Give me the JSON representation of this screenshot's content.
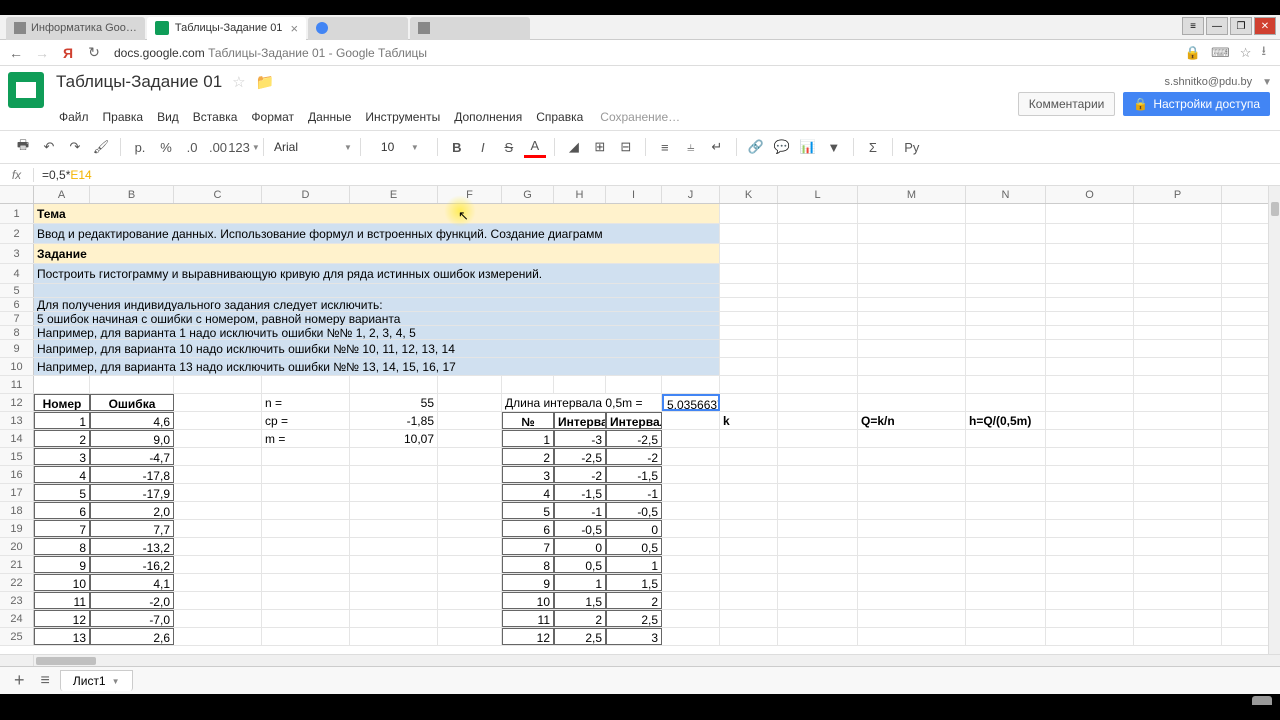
{
  "browser": {
    "tabs": [
      {
        "label": "Информатика Goo…",
        "active": false
      },
      {
        "label": "Таблицы-Задание 01",
        "active": true
      },
      {
        "label": "",
        "active": false
      },
      {
        "label": "",
        "active": false
      }
    ],
    "url_domain": "docs.google.com",
    "url_path": "   Таблицы-Задание 01 - Google Таблицы"
  },
  "window_controls": [
    "▬",
    "—",
    "❐",
    "✕"
  ],
  "header": {
    "doc_title": "Таблицы-Задание 01",
    "user_email": "s.shnitko@pdu.by",
    "comments_btn": "Комментарии",
    "share_btn": "Настройки доступа"
  },
  "menus": [
    "Файл",
    "Правка",
    "Вид",
    "Вставка",
    "Формат",
    "Данные",
    "Инструменты",
    "Дополнения",
    "Справка"
  ],
  "saving_label": "Сохранение…",
  "toolbar": {
    "font": "Arial",
    "size": "10",
    "format_123": "123"
  },
  "formula_bar": {
    "prefix": "=0,5*",
    "ref": "E14"
  },
  "columns": [
    {
      "label": "A",
      "w": 56
    },
    {
      "label": "B",
      "w": 84
    },
    {
      "label": "C",
      "w": 88
    },
    {
      "label": "D",
      "w": 88
    },
    {
      "label": "E",
      "w": 88
    },
    {
      "label": "F",
      "w": 64
    },
    {
      "label": "G",
      "w": 52
    },
    {
      "label": "H",
      "w": 52
    },
    {
      "label": "I",
      "w": 56
    },
    {
      "label": "J",
      "w": 58
    },
    {
      "label": "K",
      "w": 58
    },
    {
      "label": "L",
      "w": 80
    },
    {
      "label": "M",
      "w": 108
    },
    {
      "label": "N",
      "w": 80
    },
    {
      "label": "O",
      "w": 88
    },
    {
      "label": "P",
      "w": 88
    }
  ],
  "sheet_rows": [
    {
      "n": 1,
      "h": 20,
      "cells": [
        {
          "c": 0,
          "span": 10,
          "cls": "bold bg-yellow",
          "t": "Тема"
        }
      ]
    },
    {
      "n": 2,
      "h": 20,
      "cells": [
        {
          "c": 0,
          "span": 10,
          "cls": "bg-blue",
          "t": "Ввод и редактирование данных. Использование формул и встроенных функций. Создание диаграмм"
        }
      ]
    },
    {
      "n": 3,
      "h": 20,
      "cells": [
        {
          "c": 0,
          "span": 10,
          "cls": "bold bg-yellow",
          "t": "Задание"
        }
      ]
    },
    {
      "n": 4,
      "h": 20,
      "cells": [
        {
          "c": 0,
          "span": 10,
          "cls": "bg-blue",
          "t": "Построить гистограмму и выравнивающую кривую для ряда истинных ошибок измерений."
        }
      ]
    },
    {
      "n": 5,
      "h": 14,
      "cells": [
        {
          "c": 0,
          "span": 10,
          "cls": "bg-blue",
          "t": ""
        }
      ]
    },
    {
      "n": 6,
      "h": 14,
      "cells": [
        {
          "c": 0,
          "span": 10,
          "cls": "bg-blue",
          "t": "Для получения индивидуального задания следует исключить:"
        }
      ]
    },
    {
      "n": 7,
      "h": 14,
      "cells": [
        {
          "c": 0,
          "span": 10,
          "cls": "bg-blue",
          "t": "5 ошибок начиная с ошибки с номером, равной номеру варианта"
        }
      ]
    },
    {
      "n": 8,
      "h": 14,
      "cells": [
        {
          "c": 0,
          "span": 10,
          "cls": "bg-blue",
          "t": "Например, для варианта 1 надо исключить ошибки №№ 1, 2, 3, 4, 5"
        }
      ]
    },
    {
      "n": 9,
      "h": 18,
      "cells": [
        {
          "c": 0,
          "span": 10,
          "cls": "bg-blue",
          "t": "Например, для варианта 10 надо исключить ошибки №№ 10, 11, 12, 13, 14"
        }
      ]
    },
    {
      "n": 10,
      "h": 18,
      "cells": [
        {
          "c": 0,
          "span": 10,
          "cls": "bg-blue",
          "t": "Например, для варианта 13 надо исключить ошибки №№ 13, 14, 15, 16, 17"
        }
      ]
    },
    {
      "n": 11,
      "h": 18,
      "cells": []
    },
    {
      "n": 12,
      "h": 18,
      "cells": [
        {
          "c": 0,
          "cls": "bold center bordered",
          "t": "Номер"
        },
        {
          "c": 1,
          "cls": "bold center bordered",
          "t": "Ошибка"
        },
        {
          "c": 3,
          "t": "n ="
        },
        {
          "c": 4,
          "cls": "right",
          "t": "55"
        },
        {
          "c": 6,
          "span": 3,
          "t": "Длина интервала 0,5m ="
        },
        {
          "c": 9,
          "cls": "right selected-cell",
          "t": "5,0356637"
        }
      ]
    },
    {
      "n": 13,
      "h": 18,
      "cells": [
        {
          "c": 0,
          "cls": "right bordered",
          "t": "1"
        },
        {
          "c": 1,
          "cls": "right bordered",
          "t": "4,6"
        },
        {
          "c": 3,
          "t": "ср ="
        },
        {
          "c": 4,
          "cls": "right",
          "t": "-1,85"
        },
        {
          "c": 6,
          "cls": "bold center bordered",
          "t": "№"
        },
        {
          "c": 7,
          "cls": "bold bordered",
          "t": "Интервал в долях m"
        },
        {
          "c": 8,
          "cls": "bold bordered",
          "t": "Интервал"
        },
        {
          "c": 10,
          "cls": "bold",
          "t": "k"
        },
        {
          "c": 12,
          "cls": "bold",
          "t": "Q=k/n"
        },
        {
          "c": 13,
          "cls": "bold",
          "t": "h=Q/(0,5m)"
        }
      ]
    },
    {
      "n": 14,
      "h": 18,
      "cells": [
        {
          "c": 0,
          "cls": "right bordered",
          "t": "2"
        },
        {
          "c": 1,
          "cls": "right bordered",
          "t": "9,0"
        },
        {
          "c": 3,
          "t": "m ="
        },
        {
          "c": 4,
          "cls": "right",
          "t": "10,07"
        },
        {
          "c": 6,
          "cls": "right bordered",
          "t": "1"
        },
        {
          "c": 7,
          "cls": "right bordered",
          "t": "-3"
        },
        {
          "c": 8,
          "cls": "right bordered",
          "t": "-2,5"
        }
      ]
    },
    {
      "n": 15,
      "h": 18,
      "cells": [
        {
          "c": 0,
          "cls": "right bordered",
          "t": "3"
        },
        {
          "c": 1,
          "cls": "right bordered",
          "t": "-4,7"
        },
        {
          "c": 6,
          "cls": "right bordered",
          "t": "2"
        },
        {
          "c": 7,
          "cls": "right bordered",
          "t": "-2,5"
        },
        {
          "c": 8,
          "cls": "right bordered",
          "t": "-2"
        }
      ]
    },
    {
      "n": 16,
      "h": 18,
      "cells": [
        {
          "c": 0,
          "cls": "right bordered",
          "t": "4"
        },
        {
          "c": 1,
          "cls": "right bordered",
          "t": "-17,8"
        },
        {
          "c": 6,
          "cls": "right bordered",
          "t": "3"
        },
        {
          "c": 7,
          "cls": "right bordered",
          "t": "-2"
        },
        {
          "c": 8,
          "cls": "right bordered",
          "t": "-1,5"
        }
      ]
    },
    {
      "n": 17,
      "h": 18,
      "cells": [
        {
          "c": 0,
          "cls": "right bordered",
          "t": "5"
        },
        {
          "c": 1,
          "cls": "right bordered",
          "t": "-17,9"
        },
        {
          "c": 6,
          "cls": "right bordered",
          "t": "4"
        },
        {
          "c": 7,
          "cls": "right bordered",
          "t": "-1,5"
        },
        {
          "c": 8,
          "cls": "right bordered",
          "t": "-1"
        }
      ]
    },
    {
      "n": 18,
      "h": 18,
      "cells": [
        {
          "c": 0,
          "cls": "right bordered",
          "t": "6"
        },
        {
          "c": 1,
          "cls": "right bordered",
          "t": "2,0"
        },
        {
          "c": 6,
          "cls": "right bordered",
          "t": "5"
        },
        {
          "c": 7,
          "cls": "right bordered",
          "t": "-1"
        },
        {
          "c": 8,
          "cls": "right bordered",
          "t": "-0,5"
        }
      ]
    },
    {
      "n": 19,
      "h": 18,
      "cells": [
        {
          "c": 0,
          "cls": "right bordered",
          "t": "7"
        },
        {
          "c": 1,
          "cls": "right bordered",
          "t": "7,7"
        },
        {
          "c": 6,
          "cls": "right bordered",
          "t": "6"
        },
        {
          "c": 7,
          "cls": "right bordered",
          "t": "-0,5"
        },
        {
          "c": 8,
          "cls": "right bordered",
          "t": "0"
        }
      ]
    },
    {
      "n": 20,
      "h": 18,
      "cells": [
        {
          "c": 0,
          "cls": "right bordered",
          "t": "8"
        },
        {
          "c": 1,
          "cls": "right bordered",
          "t": "-13,2"
        },
        {
          "c": 6,
          "cls": "right bordered",
          "t": "7"
        },
        {
          "c": 7,
          "cls": "right bordered",
          "t": "0"
        },
        {
          "c": 8,
          "cls": "right bordered",
          "t": "0,5"
        }
      ]
    },
    {
      "n": 21,
      "h": 18,
      "cells": [
        {
          "c": 0,
          "cls": "right bordered",
          "t": "9"
        },
        {
          "c": 1,
          "cls": "right bordered",
          "t": "-16,2"
        },
        {
          "c": 6,
          "cls": "right bordered",
          "t": "8"
        },
        {
          "c": 7,
          "cls": "right bordered",
          "t": "0,5"
        },
        {
          "c": 8,
          "cls": "right bordered",
          "t": "1"
        }
      ]
    },
    {
      "n": 22,
      "h": 18,
      "cells": [
        {
          "c": 0,
          "cls": "right bordered",
          "t": "10"
        },
        {
          "c": 1,
          "cls": "right bordered",
          "t": "4,1"
        },
        {
          "c": 6,
          "cls": "right bordered",
          "t": "9"
        },
        {
          "c": 7,
          "cls": "right bordered",
          "t": "1"
        },
        {
          "c": 8,
          "cls": "right bordered",
          "t": "1,5"
        }
      ]
    },
    {
      "n": 23,
      "h": 18,
      "cells": [
        {
          "c": 0,
          "cls": "right bordered",
          "t": "11"
        },
        {
          "c": 1,
          "cls": "right bordered",
          "t": "-2,0"
        },
        {
          "c": 6,
          "cls": "right bordered",
          "t": "10"
        },
        {
          "c": 7,
          "cls": "right bordered",
          "t": "1,5"
        },
        {
          "c": 8,
          "cls": "right bordered",
          "t": "2"
        }
      ]
    },
    {
      "n": 24,
      "h": 18,
      "cells": [
        {
          "c": 0,
          "cls": "right bordered",
          "t": "12"
        },
        {
          "c": 1,
          "cls": "right bordered",
          "t": "-7,0"
        },
        {
          "c": 6,
          "cls": "right bordered",
          "t": "11"
        },
        {
          "c": 7,
          "cls": "right bordered",
          "t": "2"
        },
        {
          "c": 8,
          "cls": "right bordered",
          "t": "2,5"
        }
      ]
    },
    {
      "n": 25,
      "h": 18,
      "cells": [
        {
          "c": 0,
          "cls": "right bordered",
          "t": "13"
        },
        {
          "c": 1,
          "cls": "right bordered",
          "t": "2,6"
        },
        {
          "c": 6,
          "cls": "right bordered",
          "t": "12"
        },
        {
          "c": 7,
          "cls": "right bordered",
          "t": "2,5"
        },
        {
          "c": 8,
          "cls": "right bordered",
          "t": "3"
        }
      ]
    }
  ],
  "sheet_tab": "Лист1"
}
